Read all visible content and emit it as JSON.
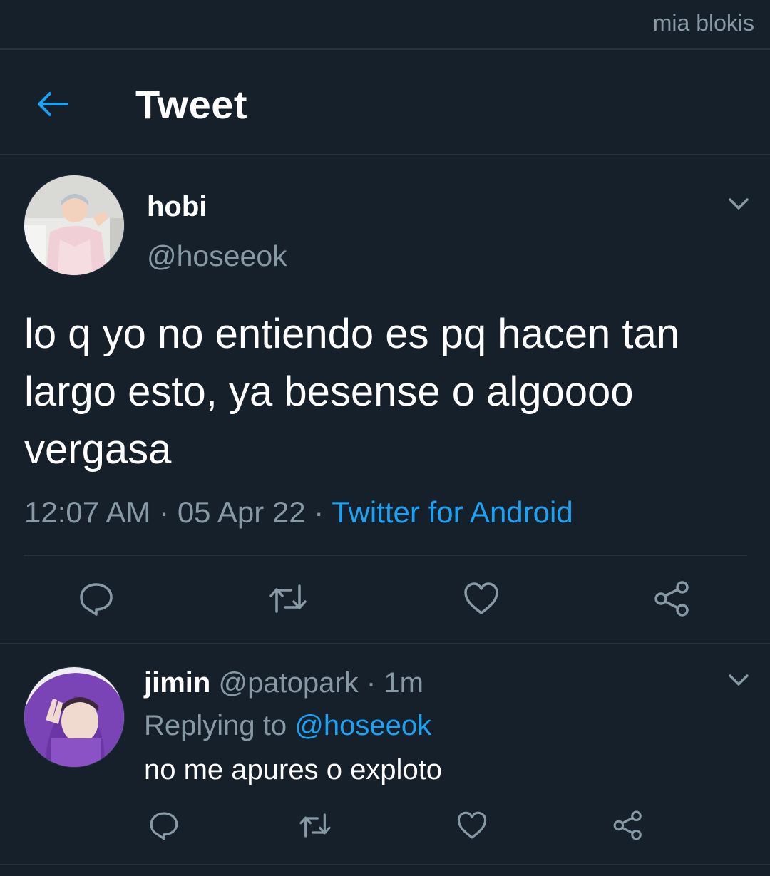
{
  "watermark": "mia blokis",
  "header": {
    "title": "Tweet",
    "back_icon": "arrow-left-icon"
  },
  "main_tweet": {
    "display_name": "hobi",
    "handle": "@hoseeok",
    "text": "lo q yo no entiendo es pq hacen tan largo esto, ya besense o algoooo vergasa",
    "time": "12:07 AM",
    "date": "05 Apr 22",
    "separator": "·",
    "source": "Twitter for Android",
    "actions": [
      "reply-icon",
      "retweet-icon",
      "like-icon",
      "share-icon"
    ]
  },
  "reply": {
    "display_name": "jimin",
    "handle": "@patopark",
    "separator": "·",
    "time": "1m",
    "replying_to_label": "Replying to",
    "replying_to_handle": "@hoseeok",
    "text": "no me apures o exploto",
    "actions": [
      "reply-icon",
      "retweet-icon",
      "like-icon",
      "share-icon"
    ]
  },
  "colors": {
    "background": "#15202b",
    "divider": "#253341",
    "text_primary": "#ffffff",
    "text_secondary": "#8899a6",
    "accent": "#1da1f2"
  }
}
